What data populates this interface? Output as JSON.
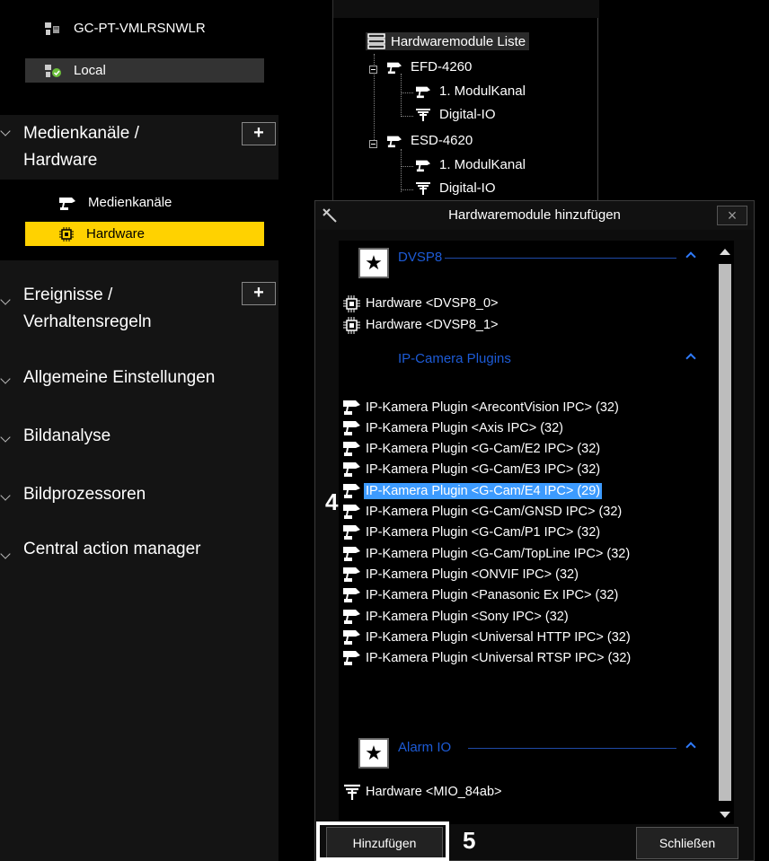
{
  "sidebar": {
    "servers": [
      {
        "label": "GC-PT-VMLRSNWLR",
        "active": false
      },
      {
        "label": "Local",
        "active": true
      }
    ],
    "sections": [
      {
        "line1": "Medienkanäle /",
        "line2": "Hardware",
        "plus": "+"
      },
      {
        "line1": "Ereignisse /",
        "line2": "Verhaltensregeln",
        "plus": "+"
      }
    ],
    "media_sub": [
      {
        "label": "Medienkanäle",
        "icon": "camera-icon"
      },
      {
        "label": "Hardware",
        "icon": "chip-icon"
      }
    ],
    "other_sections": [
      "Allgemeine Einstellungen",
      "Bildanalyse",
      "Bildprozessoren",
      "Central action manager"
    ]
  },
  "tree": {
    "root": "Hardwaremodule Liste",
    "modules": [
      {
        "name": "EFD-4260",
        "children": [
          "1. ModulKanal",
          "Digital-IO"
        ]
      },
      {
        "name": "ESD-4620",
        "children": [
          "1. ModulKanal",
          "Digital-IO"
        ]
      }
    ]
  },
  "dialog": {
    "title": "Hardwaremodule hinzufügen",
    "close": "×",
    "groups": {
      "dvsp8": {
        "name": "DVSP8",
        "items": [
          "Hardware <DVSP8_0>",
          "Hardware <DVSP8_1>"
        ]
      },
      "ip": {
        "name": "IP-Camera Plugins",
        "items": [
          "IP-Kamera Plugin <ArecontVision IPC> (32)",
          "IP-Kamera Plugin <Axis IPC> (32)",
          "IP-Kamera Plugin <G-Cam/E2 IPC> (32)",
          "IP-Kamera Plugin <G-Cam/E3 IPC> (32)",
          "IP-Kamera Plugin <G-Cam/E4 IPC> (29)",
          "IP-Kamera Plugin <G-Cam/GNSD IPC> (32)",
          "IP-Kamera Plugin <G-Cam/P1 IPC> (32)",
          "IP-Kamera Plugin <G-Cam/TopLine IPC> (32)",
          "IP-Kamera Plugin <ONVIF IPC> (32)",
          "IP-Kamera Plugin <Panasonic Ex IPC> (32)",
          "IP-Kamera Plugin <Sony IPC> (32)",
          "IP-Kamera Plugin <Universal HTTP IPC> (32)",
          "IP-Kamera Plugin <Universal RTSP IPC> (32)"
        ],
        "selected_index": 4
      },
      "alarm": {
        "name": "Alarm IO",
        "items": [
          "Hardware <MIO_84ab>"
        ]
      }
    },
    "buttons": {
      "add": "Hinzufügen",
      "close": "Schließen"
    }
  },
  "steps": {
    "select": "4",
    "add": "5"
  },
  "colors": {
    "selected_nav": "#ffd200",
    "selected_row": "#3d9bff",
    "group_header": "#1d5bd6"
  }
}
